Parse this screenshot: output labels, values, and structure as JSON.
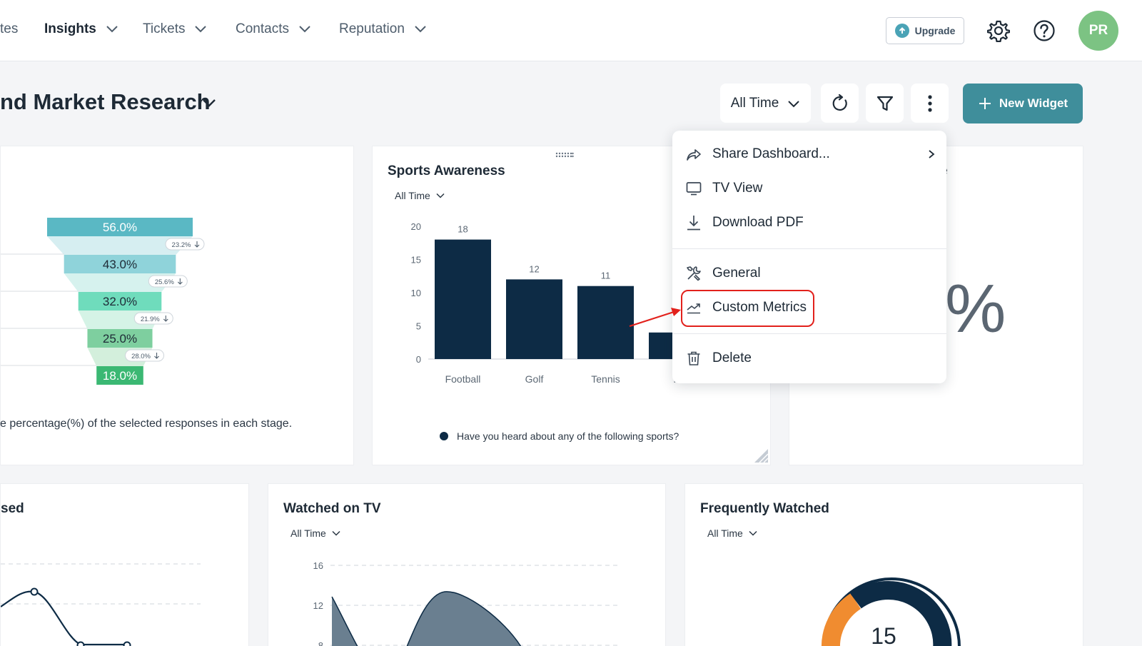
{
  "nav": {
    "items": [
      {
        "label": "tes",
        "active": false,
        "chevron": false
      },
      {
        "label": "Insights",
        "active": true,
        "chevron": true
      },
      {
        "label": "Tickets",
        "active": false,
        "chevron": true
      },
      {
        "label": "Contacts",
        "active": false,
        "chevron": true
      },
      {
        "label": "Reputation",
        "active": false,
        "chevron": true
      }
    ],
    "upgrade_label": "Upgrade",
    "avatar_initials": "PR"
  },
  "dashboard": {
    "title": "nd Market Research",
    "time_filter": "All Time",
    "new_widget_label": "New Widget"
  },
  "menu": {
    "items": [
      {
        "label": "Share Dashboard...",
        "icon": "share-icon",
        "has_submenu": true
      },
      {
        "label": "TV View",
        "icon": "tv-icon"
      },
      {
        "label": "Download PDF",
        "icon": "download-icon"
      },
      {
        "label": "General",
        "icon": "tools-icon"
      },
      {
        "label": "Custom Metrics",
        "icon": "trend-icon",
        "highlighted": true
      },
      {
        "label": "Delete",
        "icon": "trash-icon"
      }
    ]
  },
  "funnel_card": {
    "footer": "e percentage(%) of the selected responses in each stage.",
    "stages": [
      "56.0%",
      "43.0%",
      "32.0%",
      "25.0%",
      "18.0%"
    ],
    "drops": [
      "23.2%",
      "25.6%",
      "21.9%",
      "28.0%"
    ]
  },
  "sports_card": {
    "title": "Sports Awareness",
    "time": "All Time",
    "legend": "Have you heard about any of the following sports?",
    "colors": {
      "bar": "#0d2b45"
    }
  },
  "right_card": {
    "title_fragment": "e",
    "big_value": "%"
  },
  "bottom_left_card": {
    "title": "sed"
  },
  "watched_card": {
    "title": "Watched on TV",
    "time": "All Time"
  },
  "frequent_card": {
    "title": "Frequently Watched",
    "time": "All Time",
    "gauge_value": "15"
  },
  "chart_data": [
    {
      "type": "bar",
      "title": "Sports Awareness",
      "categories": [
        "Football",
        "Golf",
        "Tennis",
        "N"
      ],
      "values": [
        18,
        12,
        11,
        4
      ],
      "data_labels": [
        "18",
        "12",
        "11",
        ""
      ],
      "ylim": [
        0,
        20
      ],
      "yticks": [
        0,
        5,
        10,
        15,
        20
      ],
      "grid": false,
      "legend": "Have you heard about any of the following sports?",
      "legend_position": "bottom"
    },
    {
      "type": "area",
      "title": "Watched on TV",
      "yticks": [
        8,
        12,
        16
      ],
      "ylim": [
        8,
        16
      ],
      "grid": true
    }
  ]
}
